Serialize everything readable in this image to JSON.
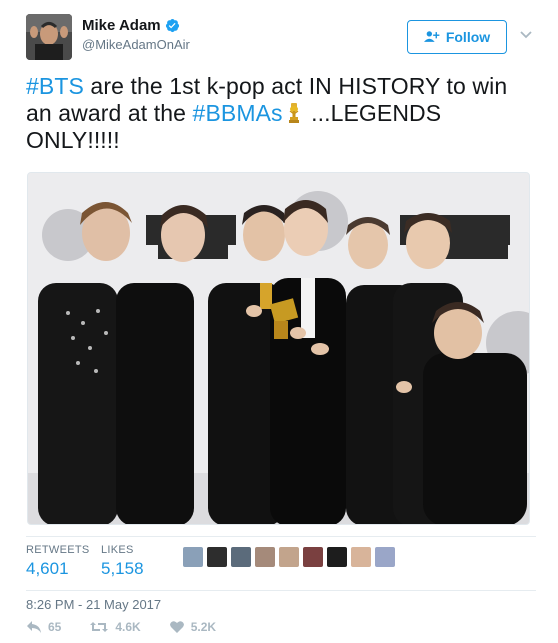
{
  "author": {
    "display_name": "Mike Adam",
    "handle": "@MikeAdamOnAir",
    "avatar": "avatar-photo",
    "verified_icon": "verified-badge-icon"
  },
  "follow_button": {
    "label": "Follow",
    "icon": "add-user-icon"
  },
  "more_icon": "chevron-down-icon",
  "tweet": {
    "part1_hashtag": "#BTS",
    "part2": " are the 1st k-pop act IN HISTORY to win an award at the ",
    "part3_hashtag": "#BBMAs",
    "emoji": "trophy-icon",
    "part4": " ...LEGENDS ONLY!!!!!"
  },
  "photo": {
    "subject": "group-photo-with-award"
  },
  "stats": {
    "retweets_label": "RETWEETS",
    "retweets_value": "4,601",
    "likes_label": "LIKES",
    "likes_value": "5,158"
  },
  "timestamp": "8:26 PM - 21 May 2017",
  "actions": {
    "reply_count": "65",
    "retweet_count": "4.6K",
    "like_count": "5.2K"
  },
  "colors": {
    "accent": "#1b95e0",
    "text": "#14171a",
    "muted": "#657786",
    "action_gray": "#aab8c2"
  }
}
